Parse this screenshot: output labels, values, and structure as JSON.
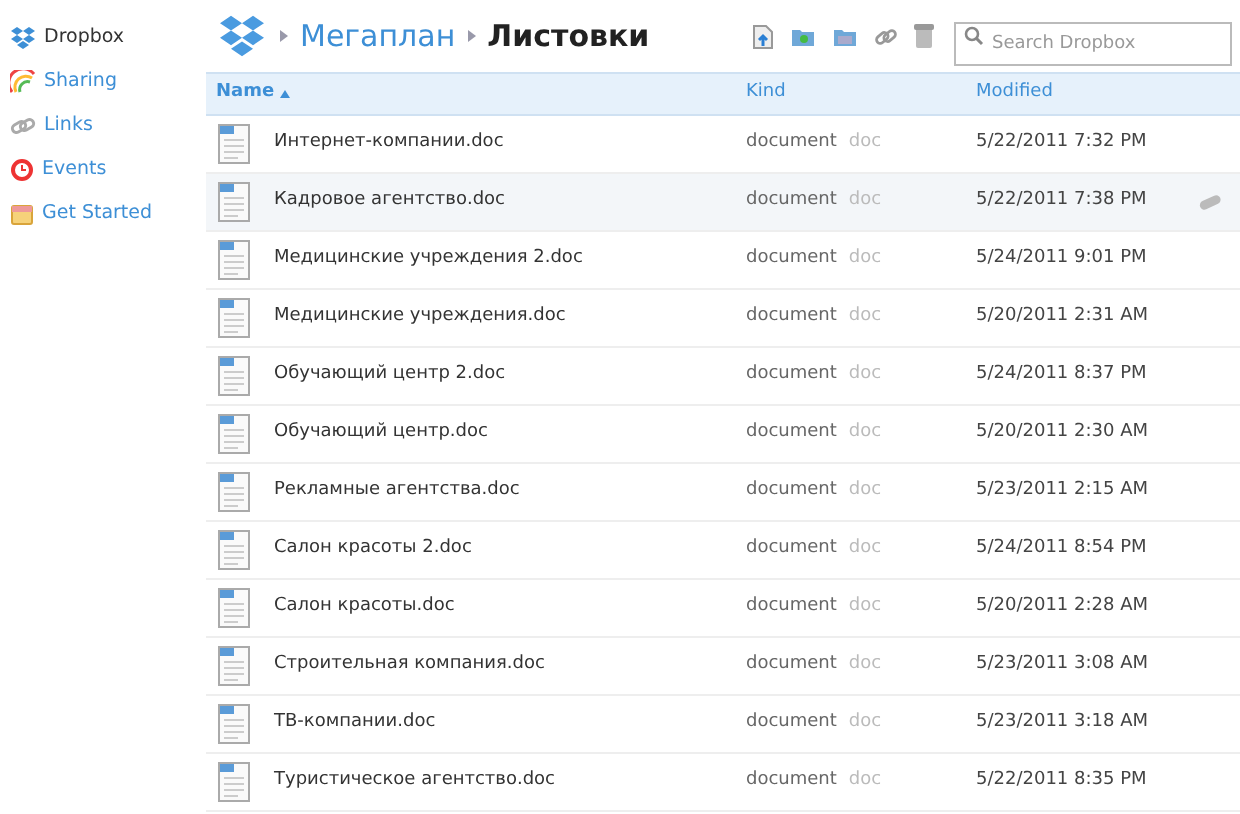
{
  "sidebar": {
    "items": [
      {
        "label": "Dropbox",
        "kind": "dropbox",
        "selected": true
      },
      {
        "label": "Sharing",
        "kind": "sharing",
        "selected": false
      },
      {
        "label": "Links",
        "kind": "links",
        "selected": false
      },
      {
        "label": "Events",
        "kind": "events",
        "selected": false
      },
      {
        "label": "Get Started",
        "kind": "start",
        "selected": false
      }
    ]
  },
  "breadcrumb": [
    "Мегаплан",
    "Листовки"
  ],
  "search": {
    "placeholder": "Search Dropbox"
  },
  "table": {
    "columns": [
      {
        "label": "Name",
        "sorted_ascending": true
      },
      {
        "label": "Kind"
      },
      {
        "label": "Modified"
      }
    ],
    "rows": [
      {
        "name": "Интернет-компании.doc",
        "kind": "document",
        "ext": "doc",
        "modified": "5/22/2011 7:32 PM",
        "selected": false
      },
      {
        "name": "Кадровое агентство.doc",
        "kind": "document",
        "ext": "doc",
        "modified": "5/22/2011 7:38 PM",
        "selected": true
      },
      {
        "name": "Медицинские учреждения 2.doc",
        "kind": "document",
        "ext": "doc",
        "modified": "5/24/2011 9:01 PM",
        "selected": false
      },
      {
        "name": "Медицинские учреждения.doc",
        "kind": "document",
        "ext": "doc",
        "modified": "5/20/2011 2:31 AM",
        "selected": false
      },
      {
        "name": "Обучающий центр 2.doc",
        "kind": "document",
        "ext": "doc",
        "modified": "5/24/2011 8:37 PM",
        "selected": false
      },
      {
        "name": "Обучающий центр.doc",
        "kind": "document",
        "ext": "doc",
        "modified": "5/20/2011 2:30 AM",
        "selected": false
      },
      {
        "name": "Рекламные агентства.doc",
        "kind": "document",
        "ext": "doc",
        "modified": "5/23/2011 2:15 AM",
        "selected": false
      },
      {
        "name": "Салон красоты 2.doc",
        "kind": "document",
        "ext": "doc",
        "modified": "5/24/2011 8:54 PM",
        "selected": false
      },
      {
        "name": "Салон красоты.doc",
        "kind": "document",
        "ext": "doc",
        "modified": "5/20/2011 2:28 AM",
        "selected": false
      },
      {
        "name": "Строительная компания.doc",
        "kind": "document",
        "ext": "doc",
        "modified": "5/23/2011 3:08 AM",
        "selected": false
      },
      {
        "name": "ТВ-компании.doc",
        "kind": "document",
        "ext": "doc",
        "modified": "5/23/2011 3:18 AM",
        "selected": false
      },
      {
        "name": "Туристическое агентство.doc",
        "kind": "document",
        "ext": "doc",
        "modified": "5/22/2011 8:35 PM",
        "selected": false
      }
    ]
  }
}
